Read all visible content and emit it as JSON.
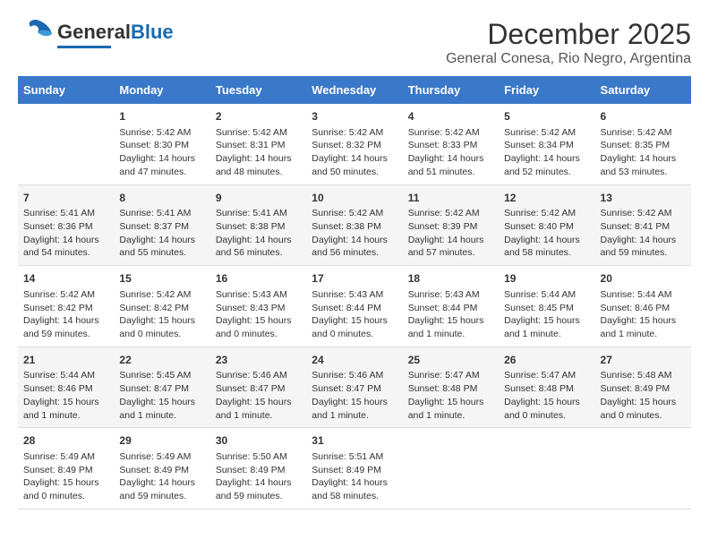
{
  "app": {
    "logo_general": "General",
    "logo_blue": "Blue"
  },
  "header": {
    "title": "December 2025",
    "subtitle": "General Conesa, Rio Negro, Argentina"
  },
  "calendar": {
    "weekdays": [
      "Sunday",
      "Monday",
      "Tuesday",
      "Wednesday",
      "Thursday",
      "Friday",
      "Saturday"
    ],
    "weeks": [
      [
        {
          "day": "",
          "content": ""
        },
        {
          "day": "1",
          "content": "Sunrise: 5:42 AM\nSunset: 8:30 PM\nDaylight: 14 hours\nand 47 minutes."
        },
        {
          "day": "2",
          "content": "Sunrise: 5:42 AM\nSunset: 8:31 PM\nDaylight: 14 hours\nand 48 minutes."
        },
        {
          "day": "3",
          "content": "Sunrise: 5:42 AM\nSunset: 8:32 PM\nDaylight: 14 hours\nand 50 minutes."
        },
        {
          "day": "4",
          "content": "Sunrise: 5:42 AM\nSunset: 8:33 PM\nDaylight: 14 hours\nand 51 minutes."
        },
        {
          "day": "5",
          "content": "Sunrise: 5:42 AM\nSunset: 8:34 PM\nDaylight: 14 hours\nand 52 minutes."
        },
        {
          "day": "6",
          "content": "Sunrise: 5:42 AM\nSunset: 8:35 PM\nDaylight: 14 hours\nand 53 minutes."
        }
      ],
      [
        {
          "day": "7",
          "content": "Sunrise: 5:41 AM\nSunset: 8:36 PM\nDaylight: 14 hours\nand 54 minutes."
        },
        {
          "day": "8",
          "content": "Sunrise: 5:41 AM\nSunset: 8:37 PM\nDaylight: 14 hours\nand 55 minutes."
        },
        {
          "day": "9",
          "content": "Sunrise: 5:41 AM\nSunset: 8:38 PM\nDaylight: 14 hours\nand 56 minutes."
        },
        {
          "day": "10",
          "content": "Sunrise: 5:42 AM\nSunset: 8:38 PM\nDaylight: 14 hours\nand 56 minutes."
        },
        {
          "day": "11",
          "content": "Sunrise: 5:42 AM\nSunset: 8:39 PM\nDaylight: 14 hours\nand 57 minutes."
        },
        {
          "day": "12",
          "content": "Sunrise: 5:42 AM\nSunset: 8:40 PM\nDaylight: 14 hours\nand 58 minutes."
        },
        {
          "day": "13",
          "content": "Sunrise: 5:42 AM\nSunset: 8:41 PM\nDaylight: 14 hours\nand 59 minutes."
        }
      ],
      [
        {
          "day": "14",
          "content": "Sunrise: 5:42 AM\nSunset: 8:42 PM\nDaylight: 14 hours\nand 59 minutes."
        },
        {
          "day": "15",
          "content": "Sunrise: 5:42 AM\nSunset: 8:42 PM\nDaylight: 15 hours\nand 0 minutes."
        },
        {
          "day": "16",
          "content": "Sunrise: 5:43 AM\nSunset: 8:43 PM\nDaylight: 15 hours\nand 0 minutes."
        },
        {
          "day": "17",
          "content": "Sunrise: 5:43 AM\nSunset: 8:44 PM\nDaylight: 15 hours\nand 0 minutes."
        },
        {
          "day": "18",
          "content": "Sunrise: 5:43 AM\nSunset: 8:44 PM\nDaylight: 15 hours\nand 1 minute."
        },
        {
          "day": "19",
          "content": "Sunrise: 5:44 AM\nSunset: 8:45 PM\nDaylight: 15 hours\nand 1 minute."
        },
        {
          "day": "20",
          "content": "Sunrise: 5:44 AM\nSunset: 8:46 PM\nDaylight: 15 hours\nand 1 minute."
        }
      ],
      [
        {
          "day": "21",
          "content": "Sunrise: 5:44 AM\nSunset: 8:46 PM\nDaylight: 15 hours\nand 1 minute."
        },
        {
          "day": "22",
          "content": "Sunrise: 5:45 AM\nSunset: 8:47 PM\nDaylight: 15 hours\nand 1 minute."
        },
        {
          "day": "23",
          "content": "Sunrise: 5:46 AM\nSunset: 8:47 PM\nDaylight: 15 hours\nand 1 minute."
        },
        {
          "day": "24",
          "content": "Sunrise: 5:46 AM\nSunset: 8:47 PM\nDaylight: 15 hours\nand 1 minute."
        },
        {
          "day": "25",
          "content": "Sunrise: 5:47 AM\nSunset: 8:48 PM\nDaylight: 15 hours\nand 1 minute."
        },
        {
          "day": "26",
          "content": "Sunrise: 5:47 AM\nSunset: 8:48 PM\nDaylight: 15 hours\nand 0 minutes."
        },
        {
          "day": "27",
          "content": "Sunrise: 5:48 AM\nSunset: 8:49 PM\nDaylight: 15 hours\nand 0 minutes."
        }
      ],
      [
        {
          "day": "28",
          "content": "Sunrise: 5:49 AM\nSunset: 8:49 PM\nDaylight: 15 hours\nand 0 minutes."
        },
        {
          "day": "29",
          "content": "Sunrise: 5:49 AM\nSunset: 8:49 PM\nDaylight: 14 hours\nand 59 minutes."
        },
        {
          "day": "30",
          "content": "Sunrise: 5:50 AM\nSunset: 8:49 PM\nDaylight: 14 hours\nand 59 minutes."
        },
        {
          "day": "31",
          "content": "Sunrise: 5:51 AM\nSunset: 8:49 PM\nDaylight: 14 hours\nand 58 minutes."
        },
        {
          "day": "",
          "content": ""
        },
        {
          "day": "",
          "content": ""
        },
        {
          "day": "",
          "content": ""
        }
      ]
    ]
  }
}
